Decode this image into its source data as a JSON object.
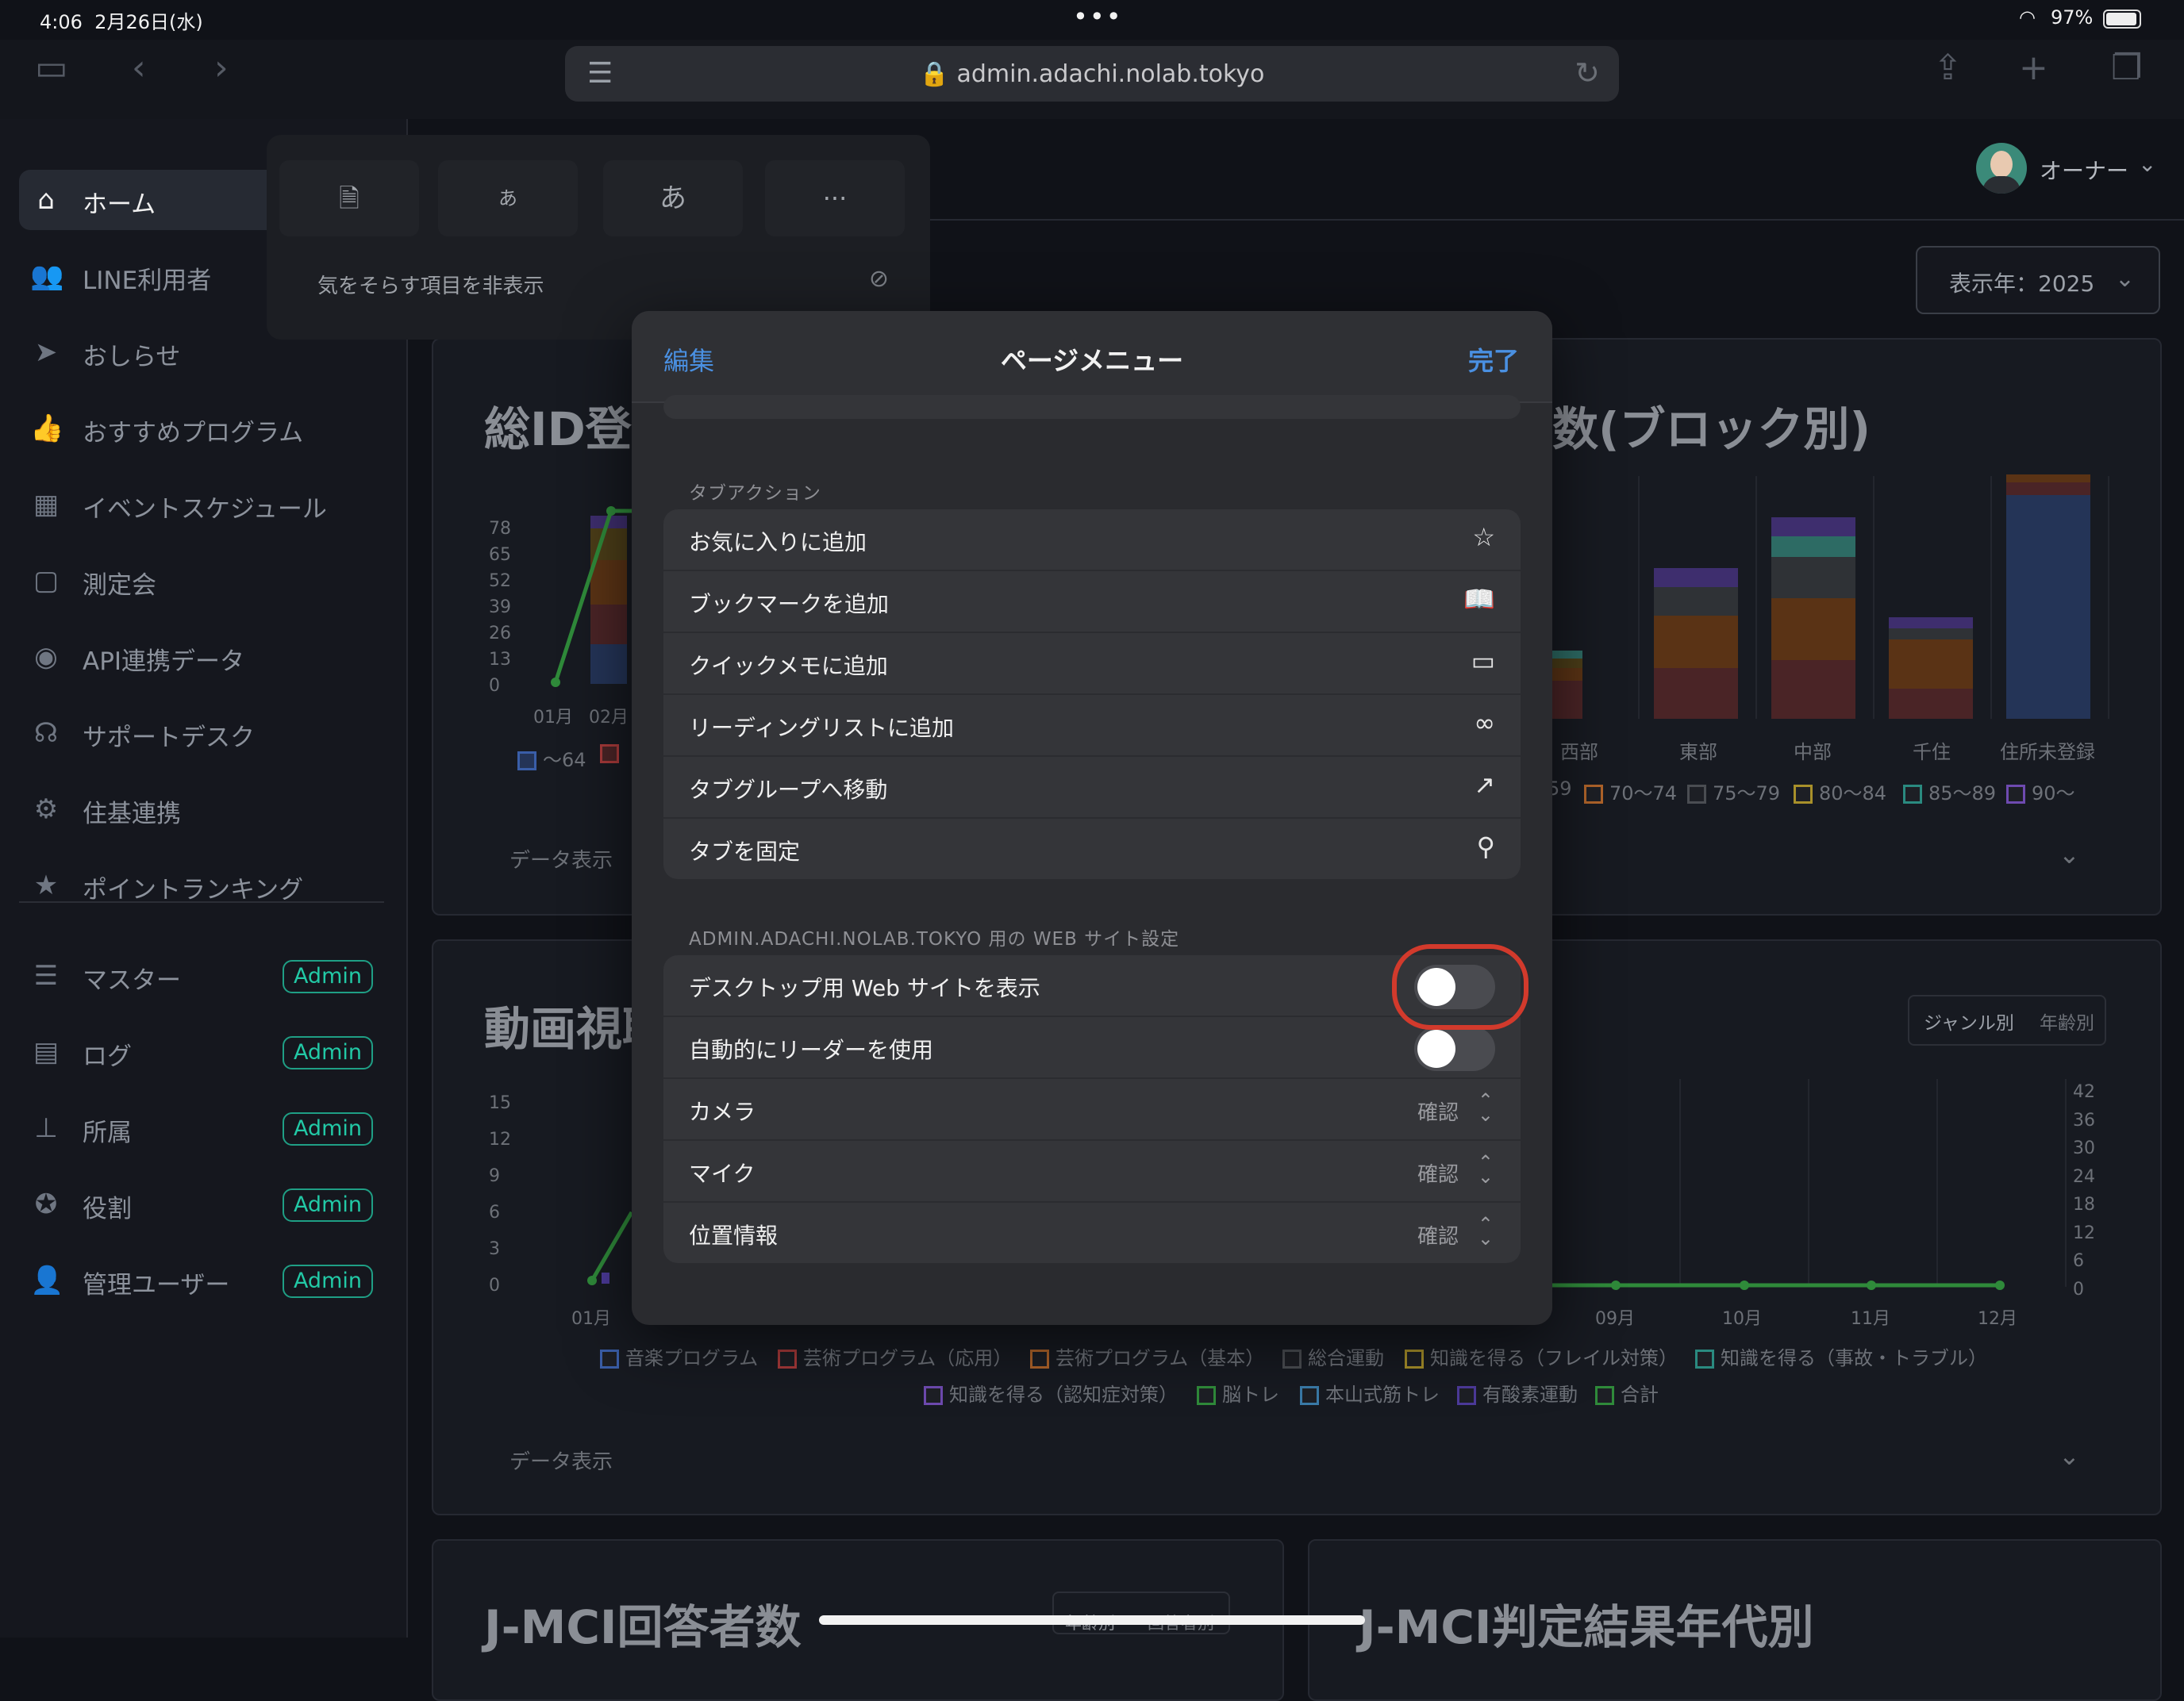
{
  "status_bar": {
    "time": "4:06",
    "date": "2月26日(水)",
    "battery": "97%"
  },
  "browser": {
    "url": "admin.adachi.nolab.tokyo"
  },
  "sidebar": {
    "items": [
      {
        "label": "ホーム",
        "icon": "home-icon",
        "glyph": "⌂"
      },
      {
        "label": "LINE利用者",
        "icon": "users-icon",
        "glyph": "👥"
      },
      {
        "label": "おしらせ",
        "icon": "paper-plane-icon",
        "glyph": "➤"
      },
      {
        "label": "おすすめプログラム",
        "icon": "thumbs-up-icon",
        "glyph": "👍"
      },
      {
        "label": "イベントスケジュール",
        "icon": "calendar-icon",
        "glyph": "▦"
      },
      {
        "label": "測定会",
        "icon": "calendar-blank-icon",
        "glyph": "▢"
      },
      {
        "label": "API連携データ",
        "icon": "api-icon",
        "glyph": "◉"
      },
      {
        "label": "サポートデスク",
        "icon": "headset-icon",
        "glyph": "☊"
      },
      {
        "label": "住基連携",
        "icon": "user-gear-icon",
        "glyph": "⚙"
      },
      {
        "label": "ポイントランキング",
        "icon": "star-icon",
        "glyph": "★"
      }
    ],
    "admin_items": [
      {
        "label": "マスター",
        "badge": "Admin",
        "icon": "server-icon",
        "glyph": "☰"
      },
      {
        "label": "ログ",
        "badge": "Admin",
        "icon": "log-icon",
        "glyph": "▤"
      },
      {
        "label": "所属",
        "badge": "Admin",
        "icon": "org-tree-icon",
        "glyph": "⊥"
      },
      {
        "label": "役割",
        "badge": "Admin",
        "icon": "award-icon",
        "glyph": "✪"
      },
      {
        "label": "管理ユーザー",
        "badge": "Admin",
        "icon": "user-lock-icon",
        "glyph": "👤"
      }
    ]
  },
  "header": {
    "owner": "オーナー",
    "year_select": "表示年：2025"
  },
  "reader_popover": {
    "btn_text_small": "あ",
    "btn_text_large": "あ",
    "btn_more": "···",
    "hide_distracting": "気をそらす項目を非表示"
  },
  "page_menu": {
    "edit": "編集",
    "title": "ページメニュー",
    "done": "完了",
    "tab_section_label": "タブアクション",
    "tab_actions": [
      {
        "label": "お気に入りに追加",
        "icon": "star-outline-icon",
        "glyph": "☆"
      },
      {
        "label": "ブックマークを追加",
        "icon": "book-icon",
        "glyph": "📖"
      },
      {
        "label": "クイックメモに追加",
        "icon": "quick-note-icon",
        "glyph": "▭"
      },
      {
        "label": "リーディングリストに追加",
        "icon": "glasses-icon",
        "glyph": "∞"
      },
      {
        "label": "タブグループへ移動",
        "icon": "move-to-group-icon",
        "glyph": "↗"
      },
      {
        "label": "タブを固定",
        "icon": "pin-icon",
        "glyph": "⚲"
      }
    ],
    "site_section_label": "ADMIN.ADACHI.NOLAB.TOKYO 用の WEB サイト設定",
    "site_settings": {
      "desktop_site": "デスクトップ用 Web サイトを表示",
      "auto_reader": "自動的にリーダーを使用",
      "camera": "カメラ",
      "camera_value": "確認",
      "mic": "マイク",
      "mic_value": "確認",
      "location": "位置情報",
      "location_value": "確認"
    }
  },
  "background": {
    "card1_title": "総ID登録",
    "card2_title": "数(ブロック別)",
    "card3_title": "動画視聴",
    "card4_title": "J-MCI回答者数",
    "card5_title": "J-MCI判定結果年代別",
    "data_view": "データ表示",
    "genre_tab": "ジャンル別",
    "age_tab": "年齢別",
    "card4_tab1": "年齢別",
    "card4_tab2": "回答者別",
    "chart1_y": [
      "78",
      "65",
      "52",
      "39",
      "26",
      "13",
      "0"
    ],
    "chart1_x": [
      "01月",
      "02月"
    ],
    "chart1_legend": "〜64",
    "chart2_x": [
      "西部",
      "東部",
      "中部",
      "千住",
      "住所未登録"
    ],
    "chart2_legend": [
      "59",
      "70〜74",
      "75〜79",
      "80〜84",
      "85〜89",
      "90〜"
    ],
    "chart3_y_left": [
      "15",
      "12",
      "9",
      "6",
      "3",
      "0"
    ],
    "chart3_y_right": [
      "42",
      "36",
      "30",
      "24",
      "18",
      "12",
      "6",
      "0"
    ],
    "chart3_x": [
      "01月",
      "09月",
      "10月",
      "11月",
      "12月"
    ],
    "chart3_legend_1": [
      "音楽プログラム",
      "芸術プログラム（応用）",
      "芸術プログラム（基本）",
      "総合運動",
      "知識を得る（フレイル対策）",
      "知識を得る（事故・トラブル）"
    ],
    "chart3_legend_2": [
      "知識を得る（認知症対策）",
      "脳トレ",
      "本山式筋トレ",
      "有酸素運動",
      "合計"
    ]
  }
}
